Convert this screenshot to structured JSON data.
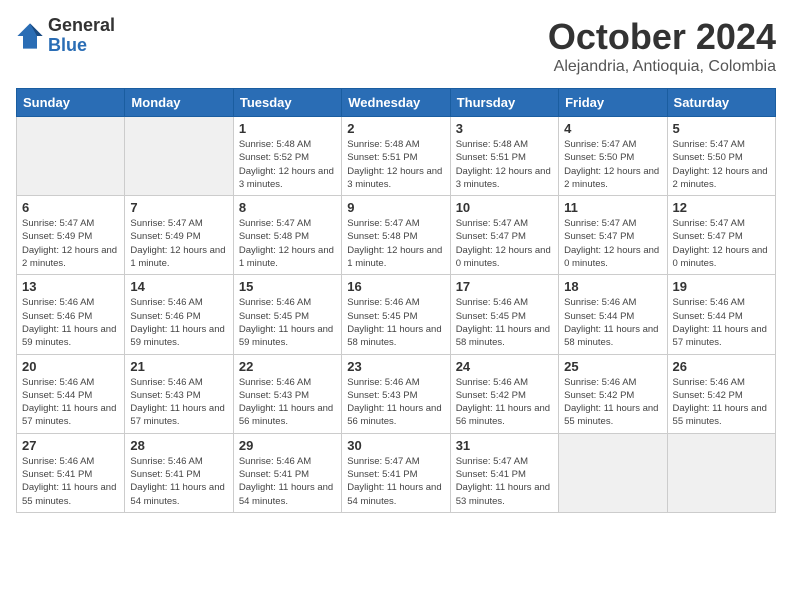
{
  "logo": {
    "general": "General",
    "blue": "Blue"
  },
  "title": "October 2024",
  "location": "Alejandria, Antioquia, Colombia",
  "days_header": [
    "Sunday",
    "Monday",
    "Tuesday",
    "Wednesday",
    "Thursday",
    "Friday",
    "Saturday"
  ],
  "weeks": [
    [
      {
        "day": "",
        "empty": true
      },
      {
        "day": "",
        "empty": true
      },
      {
        "day": "1",
        "sunrise": "5:48 AM",
        "sunset": "5:52 PM",
        "daylight": "12 hours and 3 minutes."
      },
      {
        "day": "2",
        "sunrise": "5:48 AM",
        "sunset": "5:51 PM",
        "daylight": "12 hours and 3 minutes."
      },
      {
        "day": "3",
        "sunrise": "5:48 AM",
        "sunset": "5:51 PM",
        "daylight": "12 hours and 3 minutes."
      },
      {
        "day": "4",
        "sunrise": "5:47 AM",
        "sunset": "5:50 PM",
        "daylight": "12 hours and 2 minutes."
      },
      {
        "day": "5",
        "sunrise": "5:47 AM",
        "sunset": "5:50 PM",
        "daylight": "12 hours and 2 minutes."
      }
    ],
    [
      {
        "day": "6",
        "sunrise": "5:47 AM",
        "sunset": "5:49 PM",
        "daylight": "12 hours and 2 minutes."
      },
      {
        "day": "7",
        "sunrise": "5:47 AM",
        "sunset": "5:49 PM",
        "daylight": "12 hours and 1 minute."
      },
      {
        "day": "8",
        "sunrise": "5:47 AM",
        "sunset": "5:48 PM",
        "daylight": "12 hours and 1 minute."
      },
      {
        "day": "9",
        "sunrise": "5:47 AM",
        "sunset": "5:48 PM",
        "daylight": "12 hours and 1 minute."
      },
      {
        "day": "10",
        "sunrise": "5:47 AM",
        "sunset": "5:47 PM",
        "daylight": "12 hours and 0 minutes."
      },
      {
        "day": "11",
        "sunrise": "5:47 AM",
        "sunset": "5:47 PM",
        "daylight": "12 hours and 0 minutes."
      },
      {
        "day": "12",
        "sunrise": "5:47 AM",
        "sunset": "5:47 PM",
        "daylight": "12 hours and 0 minutes."
      }
    ],
    [
      {
        "day": "13",
        "sunrise": "5:46 AM",
        "sunset": "5:46 PM",
        "daylight": "11 hours and 59 minutes."
      },
      {
        "day": "14",
        "sunrise": "5:46 AM",
        "sunset": "5:46 PM",
        "daylight": "11 hours and 59 minutes."
      },
      {
        "day": "15",
        "sunrise": "5:46 AM",
        "sunset": "5:45 PM",
        "daylight": "11 hours and 59 minutes."
      },
      {
        "day": "16",
        "sunrise": "5:46 AM",
        "sunset": "5:45 PM",
        "daylight": "11 hours and 58 minutes."
      },
      {
        "day": "17",
        "sunrise": "5:46 AM",
        "sunset": "5:45 PM",
        "daylight": "11 hours and 58 minutes."
      },
      {
        "day": "18",
        "sunrise": "5:46 AM",
        "sunset": "5:44 PM",
        "daylight": "11 hours and 58 minutes."
      },
      {
        "day": "19",
        "sunrise": "5:46 AM",
        "sunset": "5:44 PM",
        "daylight": "11 hours and 57 minutes."
      }
    ],
    [
      {
        "day": "20",
        "sunrise": "5:46 AM",
        "sunset": "5:44 PM",
        "daylight": "11 hours and 57 minutes."
      },
      {
        "day": "21",
        "sunrise": "5:46 AM",
        "sunset": "5:43 PM",
        "daylight": "11 hours and 57 minutes."
      },
      {
        "day": "22",
        "sunrise": "5:46 AM",
        "sunset": "5:43 PM",
        "daylight": "11 hours and 56 minutes."
      },
      {
        "day": "23",
        "sunrise": "5:46 AM",
        "sunset": "5:43 PM",
        "daylight": "11 hours and 56 minutes."
      },
      {
        "day": "24",
        "sunrise": "5:46 AM",
        "sunset": "5:42 PM",
        "daylight": "11 hours and 56 minutes."
      },
      {
        "day": "25",
        "sunrise": "5:46 AM",
        "sunset": "5:42 PM",
        "daylight": "11 hours and 55 minutes."
      },
      {
        "day": "26",
        "sunrise": "5:46 AM",
        "sunset": "5:42 PM",
        "daylight": "11 hours and 55 minutes."
      }
    ],
    [
      {
        "day": "27",
        "sunrise": "5:46 AM",
        "sunset": "5:41 PM",
        "daylight": "11 hours and 55 minutes."
      },
      {
        "day": "28",
        "sunrise": "5:46 AM",
        "sunset": "5:41 PM",
        "daylight": "11 hours and 54 minutes."
      },
      {
        "day": "29",
        "sunrise": "5:46 AM",
        "sunset": "5:41 PM",
        "daylight": "11 hours and 54 minutes."
      },
      {
        "day": "30",
        "sunrise": "5:47 AM",
        "sunset": "5:41 PM",
        "daylight": "11 hours and 54 minutes."
      },
      {
        "day": "31",
        "sunrise": "5:47 AM",
        "sunset": "5:41 PM",
        "daylight": "11 hours and 53 minutes."
      },
      {
        "day": "",
        "empty": true
      },
      {
        "day": "",
        "empty": true
      }
    ]
  ]
}
